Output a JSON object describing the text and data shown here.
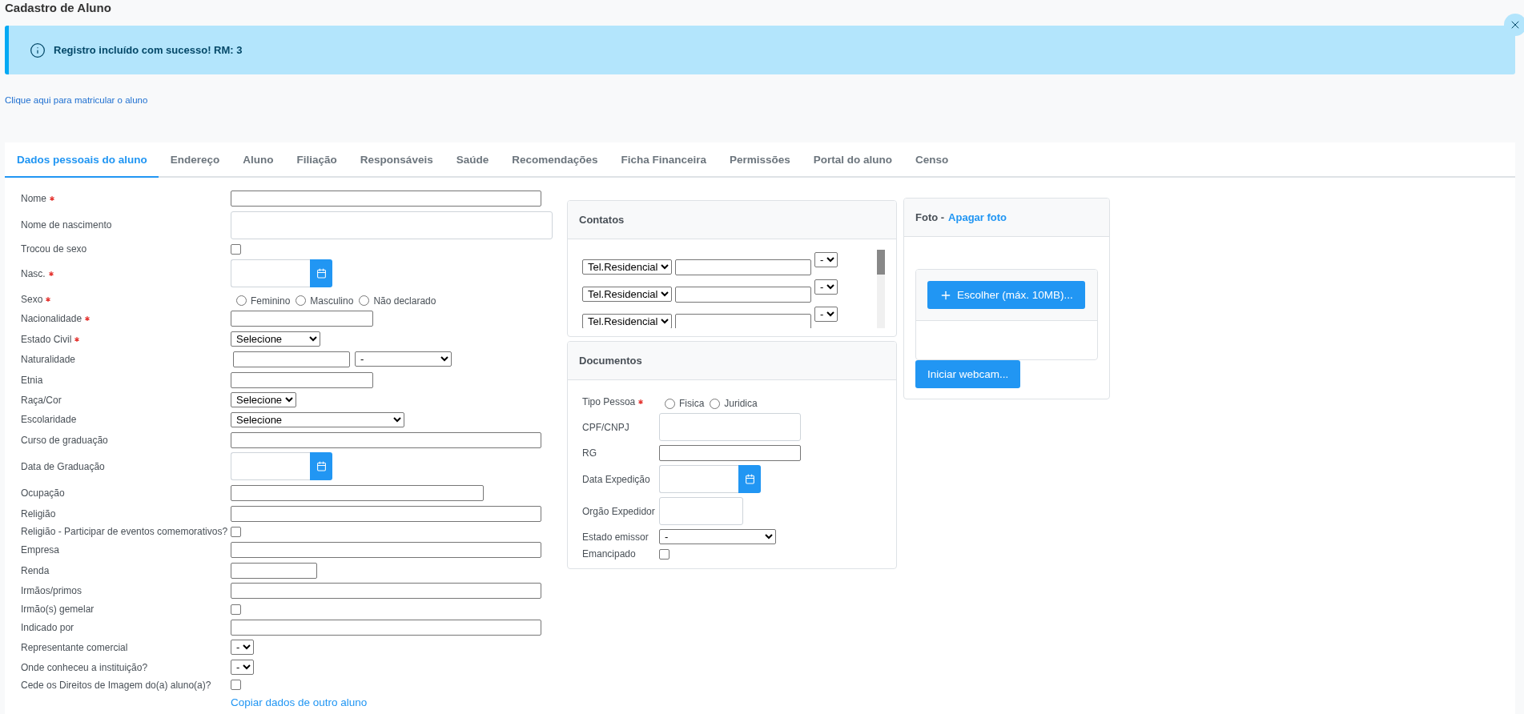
{
  "page_title": "Cadastro de Aluno",
  "message": {
    "text": "Registro incluído com sucesso! RM: 3"
  },
  "enroll_link": "Clique aqui para matricular o aluno",
  "tabs": [
    {
      "label": "Dados pessoais do aluno",
      "selected": true
    },
    {
      "label": "Endereço",
      "selected": false
    },
    {
      "label": "Aluno",
      "selected": false
    },
    {
      "label": "Filiação",
      "selected": false
    },
    {
      "label": "Responsáveis",
      "selected": false
    },
    {
      "label": "Saúde",
      "selected": false
    },
    {
      "label": "Recomendações",
      "selected": false
    },
    {
      "label": "Ficha Financeira",
      "selected": false
    },
    {
      "label": "Permissões",
      "selected": false
    },
    {
      "label": "Portal do aluno",
      "selected": false
    },
    {
      "label": "Censo",
      "selected": false
    }
  ],
  "personal_fields": [
    {
      "kind": "text",
      "label": "Nome",
      "required": true
    },
    {
      "kind": "tall",
      "label": "Nome de nascimento",
      "required": false
    },
    {
      "kind": "checkbox",
      "label": "Trocou de sexo",
      "required": false,
      "checked": false
    },
    {
      "kind": "date",
      "label": "Nasc.",
      "required": true
    },
    {
      "kind": "radio",
      "label": "Sexo",
      "required": true,
      "options": [
        {
          "label": "Feminino",
          "selected": false
        },
        {
          "label": "Masculino",
          "selected": false
        },
        {
          "label": "Não declarado",
          "selected": false
        }
      ]
    },
    {
      "kind": "text-small",
      "label": "Nacionalidade",
      "required": true
    },
    {
      "kind": "select-mid",
      "label": "Estado Civil",
      "required": true,
      "value": "Selecione"
    },
    {
      "kind": "pair",
      "label": "Naturalidade",
      "required": false,
      "value": "-"
    },
    {
      "kind": "text-small",
      "label": "Etnia",
      "required": false
    },
    {
      "kind": "select",
      "label": "Raça/Cor",
      "required": false,
      "value": "Selecione"
    },
    {
      "kind": "select-wide",
      "label": "Escolaridade",
      "required": false,
      "value": "Selecione"
    },
    {
      "kind": "text",
      "label": "Curso de graduação",
      "required": false
    },
    {
      "kind": "date",
      "label": "Data de Graduação",
      "required": false
    },
    {
      "kind": "text-mid",
      "label": "Ocupação",
      "required": false
    },
    {
      "kind": "text",
      "label": "Religião",
      "required": false
    },
    {
      "kind": "checkbox",
      "label": "Religião - Participar de eventos comemorativos?",
      "required": false,
      "checked": false
    },
    {
      "kind": "text",
      "label": "Empresa",
      "required": false
    },
    {
      "kind": "text-tiny",
      "label": "Renda",
      "required": false
    },
    {
      "kind": "text",
      "label": "Irmãos/primos",
      "required": false
    },
    {
      "kind": "checkbox",
      "label": "Irmão(s) gemelar",
      "required": false,
      "checked": false
    },
    {
      "kind": "text",
      "label": "Indicado por",
      "required": false
    },
    {
      "kind": "select",
      "label": "Representante comercial",
      "required": false,
      "value": "-"
    },
    {
      "kind": "select",
      "label": "Onde conheceu a instituição?",
      "required": false,
      "value": "-"
    },
    {
      "kind": "checkbox",
      "label": "Cede os Direitos de Imagem do(a) aluno(a)?",
      "required": false,
      "checked": false
    }
  ],
  "copy_link": "Copiar dados de outro aluno",
  "contacts": {
    "title": "Contatos",
    "rows": [
      {
        "type": "Tel.Residencial",
        "option": "-"
      },
      {
        "type": "Tel.Residencial",
        "option": "-"
      },
      {
        "type": "Tel.Residencial",
        "option": "-"
      }
    ]
  },
  "documents": {
    "title": "Documentos",
    "fields": [
      {
        "kind": "radio",
        "label": "Tipo Pessoa",
        "required": true,
        "options": [
          {
            "label": "Fisica",
            "selected": false
          },
          {
            "label": "Juridica",
            "selected": false
          }
        ]
      },
      {
        "kind": "tall",
        "label": "CPF/CNPJ",
        "required": false
      },
      {
        "kind": "text",
        "label": "RG",
        "required": false
      },
      {
        "kind": "date",
        "label": "Data Expedição",
        "required": false
      },
      {
        "kind": "tall-small",
        "label": "Orgão Expedidor",
        "required": false
      },
      {
        "kind": "select-wide",
        "label": "Estado emissor",
        "required": false,
        "value": "-"
      },
      {
        "kind": "checkbox",
        "label": "Emancipado",
        "required": false,
        "checked": false
      }
    ]
  },
  "photo": {
    "title": "Foto -",
    "delete_link": "Apagar foto",
    "choose_button": "Escolher (máx. 10MB)...",
    "webcam_button": "Iniciar webcam..."
  }
}
